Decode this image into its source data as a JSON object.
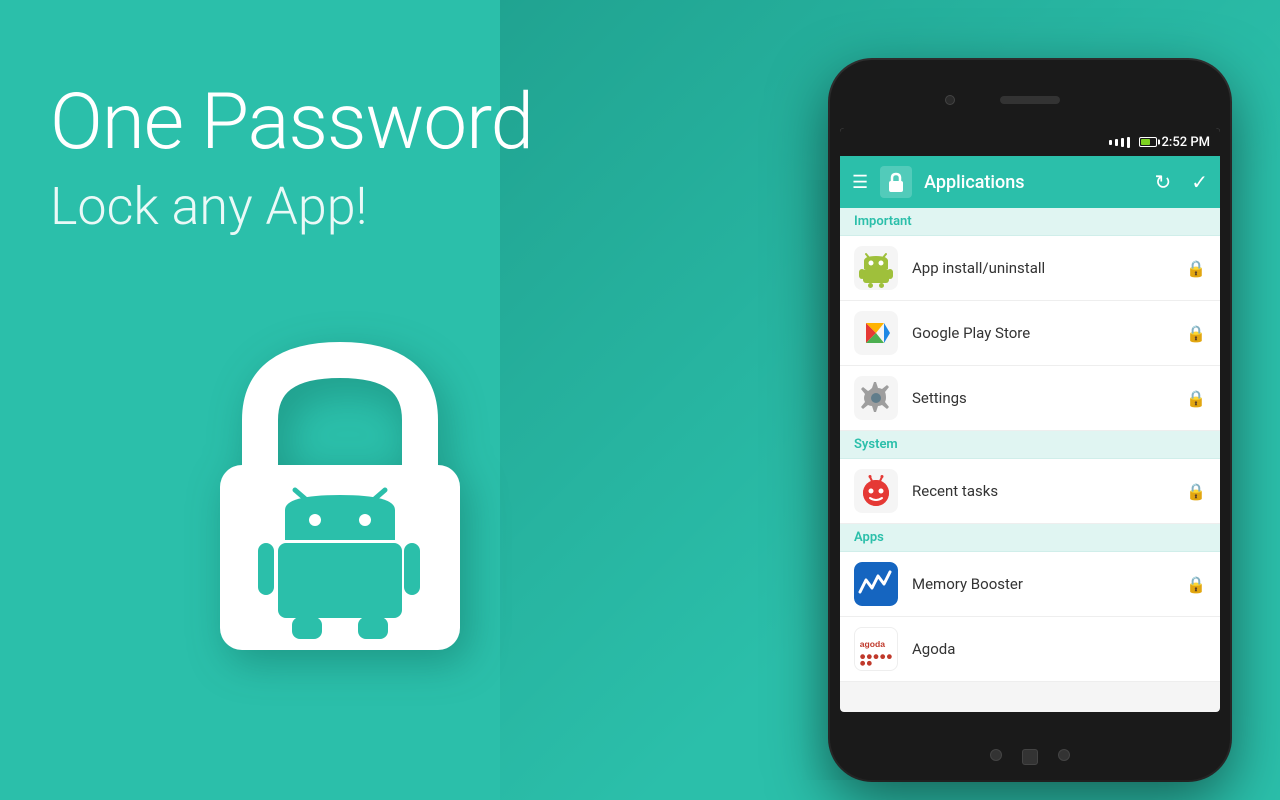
{
  "background": {
    "color": "#2bbfaa"
  },
  "left": {
    "main_title": "One Password",
    "sub_title": "Lock any App!"
  },
  "phone": {
    "status_bar": {
      "time": "2:52 PM"
    },
    "app_bar": {
      "title": "Applications",
      "menu_icon": "☰",
      "refresh_icon": "↻",
      "check_icon": "✓"
    },
    "sections": [
      {
        "name": "Important",
        "items": [
          {
            "name": "App install/uninstall",
            "locked": true,
            "icon_type": "android"
          },
          {
            "name": "Google Play Store",
            "locked": true,
            "icon_type": "playstore"
          },
          {
            "name": "Settings",
            "locked": true,
            "icon_type": "settings"
          }
        ]
      },
      {
        "name": "System",
        "items": [
          {
            "name": "Recent tasks",
            "locked": true,
            "icon_type": "tomato"
          }
        ]
      },
      {
        "name": "Apps",
        "items": [
          {
            "name": "Memory Booster",
            "locked": false,
            "icon_type": "memory"
          },
          {
            "name": "Agoda",
            "locked": false,
            "icon_type": "agoda"
          }
        ]
      }
    ]
  }
}
